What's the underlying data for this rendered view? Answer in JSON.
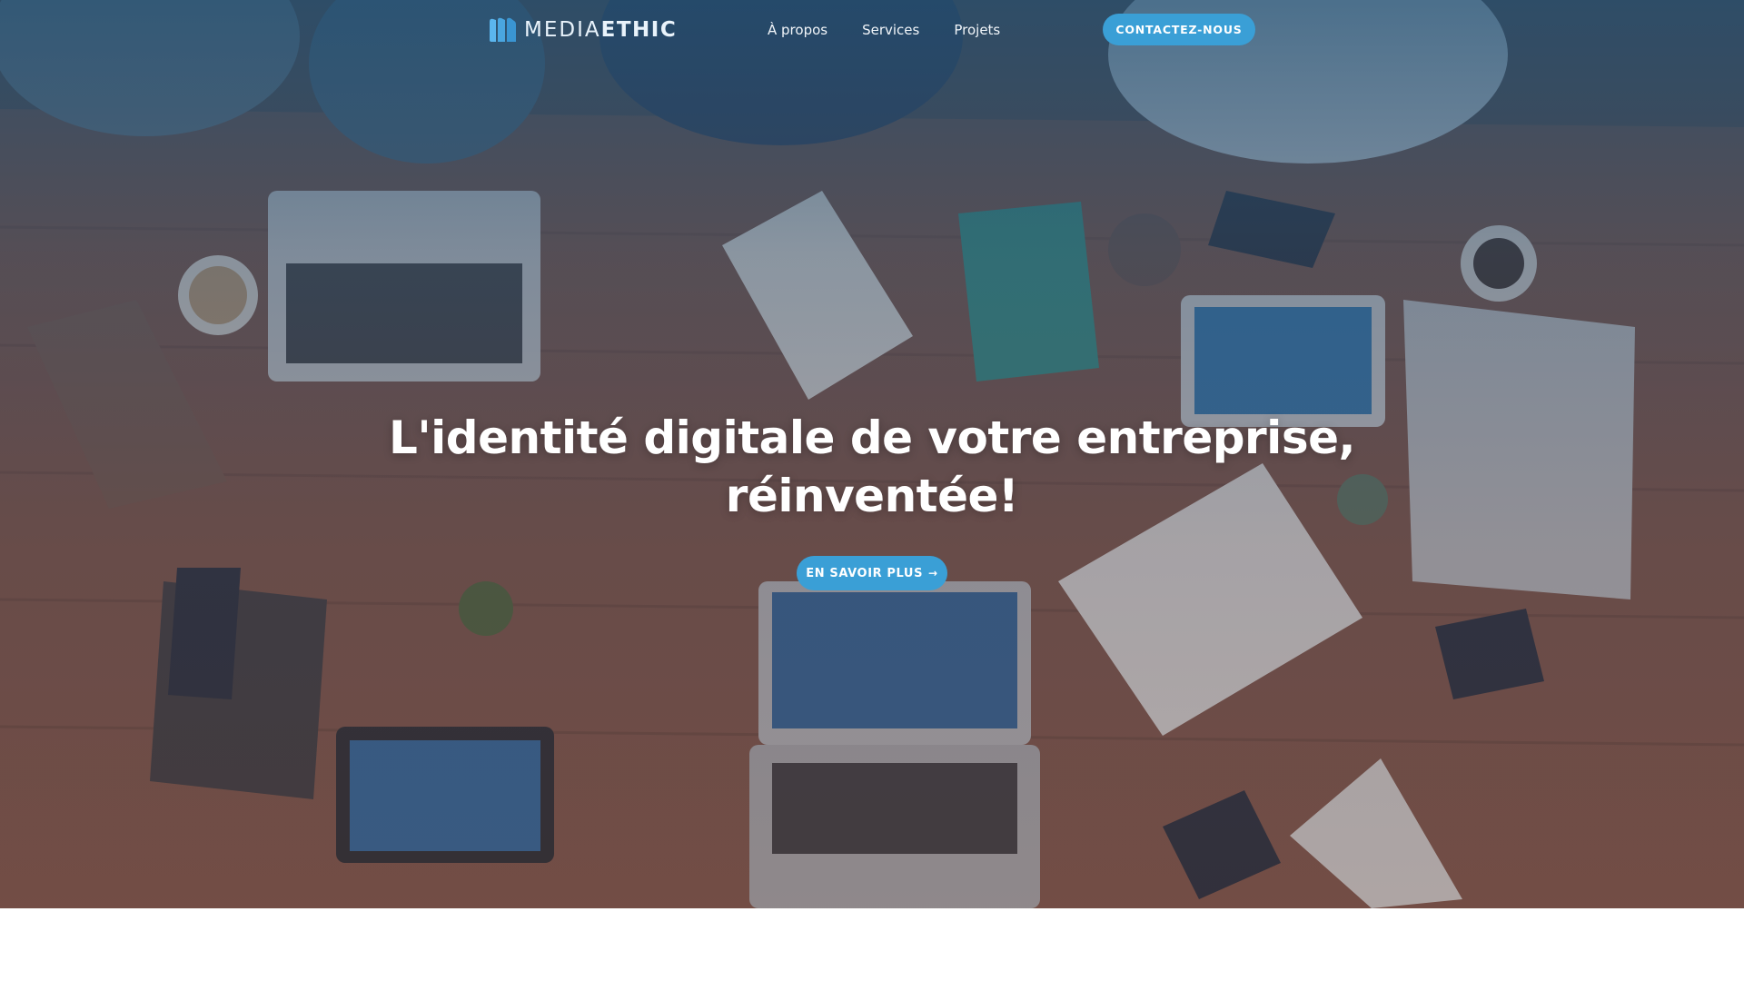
{
  "brand": {
    "name_light": "MEDIA",
    "name_bold": "ETHIC",
    "logo_icon": "mediaethic-logo-icon",
    "accent_color": "#3a9fd6"
  },
  "nav": {
    "links": [
      {
        "label": "À propos"
      },
      {
        "label": "Services"
      },
      {
        "label": "Projets"
      }
    ],
    "contact_label": "CONTACTEZ-NOUS"
  },
  "hero": {
    "headline_line1": "L'identité digitale de votre entreprise,",
    "headline_line2": "réinventée!",
    "cta_label": "EN SAVOIR PLUS",
    "cta_icon": "arrow-right-icon",
    "background": "photo of team working around a wooden table with laptops, tablets and notebooks"
  }
}
